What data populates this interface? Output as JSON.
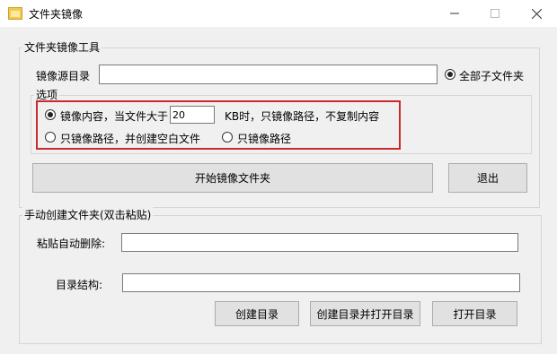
{
  "window": {
    "title": "文件夹镜像",
    "icon": "folder-icon",
    "minimize_icon": "minimize-icon",
    "maximize_icon": "maximize-icon",
    "close_icon": "close-icon"
  },
  "tool_group": {
    "label": "文件夹镜像工具",
    "source_label": "镜像源目录",
    "source_value": "",
    "all_subfolders_label": "全部子文件夹",
    "all_subfolders_checked": true,
    "options": {
      "label": "选项",
      "mirror_content_label": "镜像内容，当文件大于",
      "mirror_content_checked": true,
      "size_value": "20",
      "size_suffix": "KB时，只镜像路径，不复制内容",
      "paths_blank_files_label": "只镜像路径，并创建空白文件",
      "paths_blank_files_checked": false,
      "paths_only_label": "只镜像路径",
      "paths_only_checked": false
    },
    "start_button": "开始镜像文件夹",
    "exit_button": "退出"
  },
  "manual_group": {
    "label": "手动创建文件夹(双击粘贴)",
    "paste_label": "粘贴自动删除:",
    "paste_value": "",
    "structure_label": "目录结构:",
    "structure_value": "",
    "create_button": "创建目录",
    "create_open_button": "创建目录并打开目录",
    "open_button": "打开目录"
  },
  "colors": {
    "highlight": "#cc2a2a",
    "window_bg": "#f0f0f0"
  }
}
